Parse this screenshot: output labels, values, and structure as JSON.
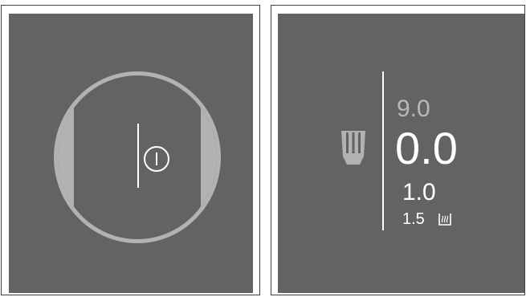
{
  "left_panel": {
    "mode": "power-off",
    "icon": "power-icon"
  },
  "right_panel": {
    "icon": "steam-nozzle-icon",
    "values": {
      "previous": "9.0",
      "current": "0.0",
      "next": "1.0",
      "next_after": "1.5"
    },
    "steam_indicator_icon": "steam-indicator-icon"
  },
  "colors": {
    "screen_bg": "#636363",
    "accent_gray": "#b2b2b2",
    "text_primary": "#ffffff",
    "text_dim": "#b8b8b8"
  }
}
